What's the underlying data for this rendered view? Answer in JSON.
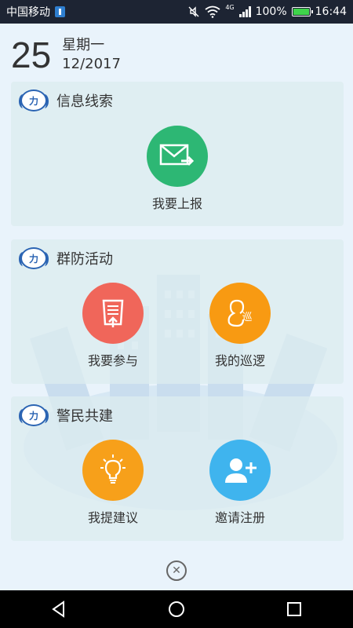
{
  "status_bar": {
    "carrier": "中国移动",
    "network": "4G",
    "battery": "100%",
    "time": "16:44"
  },
  "date": {
    "day": "25",
    "weekday": "星期一",
    "month_year": "12/2017"
  },
  "sections": [
    {
      "title": "信息线索",
      "actions": [
        {
          "label": "我要上报",
          "icon": "mail-forward-icon",
          "color": "#2db774"
        }
      ]
    },
    {
      "title": "群防活动",
      "actions": [
        {
          "label": "我要参与",
          "icon": "document-upload-icon",
          "color": "#f0665a"
        },
        {
          "label": "我的巡逻",
          "icon": "patrol-icon",
          "color": "#f89a12",
          "glyph": "巡"
        }
      ]
    },
    {
      "title": "警民共建",
      "actions": [
        {
          "label": "我提建议",
          "icon": "lightbulb-icon",
          "color": "#f7a01a"
        },
        {
          "label": "邀请注册",
          "icon": "add-user-icon",
          "color": "#3fb4ee"
        }
      ]
    }
  ],
  "close_icon": "close-circle-icon"
}
